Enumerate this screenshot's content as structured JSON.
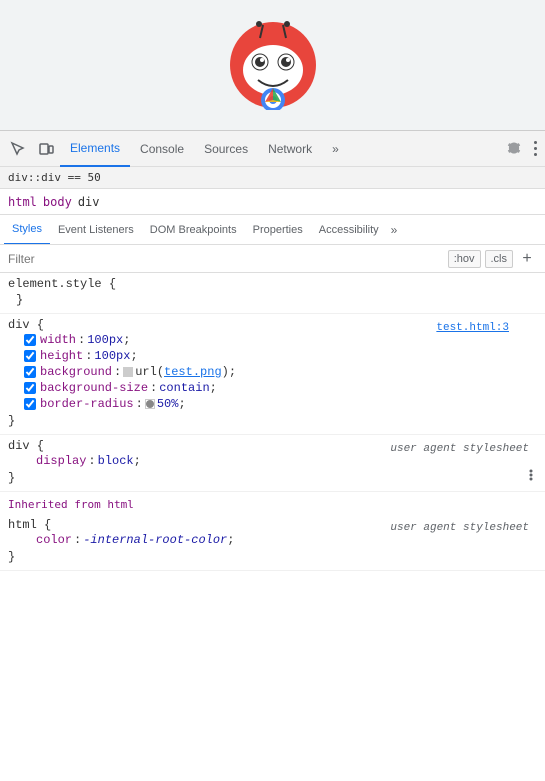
{
  "browser_preview": {
    "logo_alt": "Chrome DevTools Logo"
  },
  "devtools": {
    "path_text": "div::div == 50",
    "tabs": [
      {
        "id": "elements",
        "label": "Elements",
        "active": true
      },
      {
        "id": "console",
        "label": "Console",
        "active": false
      },
      {
        "id": "sources",
        "label": "Sources",
        "active": false
      },
      {
        "id": "network",
        "label": "Network",
        "active": false
      },
      {
        "id": "more",
        "label": "»",
        "active": false
      }
    ],
    "toolbar": {
      "more_label": "⋮",
      "settings_label": "⋮"
    },
    "breadcrumb": {
      "items": [
        "html",
        "body",
        "div"
      ]
    },
    "subtabs": [
      {
        "id": "styles",
        "label": "Styles",
        "active": true
      },
      {
        "id": "event-listeners",
        "label": "Event Listeners",
        "active": false
      },
      {
        "id": "dom-breakpoints",
        "label": "DOM Breakpoints",
        "active": false
      },
      {
        "id": "properties",
        "label": "Properties",
        "active": false
      },
      {
        "id": "accessibility",
        "label": "Accessibility",
        "active": false
      },
      {
        "id": "more2",
        "label": "»",
        "active": false
      }
    ],
    "filter": {
      "placeholder": "Filter",
      "hov_label": ":hov",
      "cls_label": ".cls",
      "add_label": "+"
    },
    "css_rules": [
      {
        "id": "element-style",
        "selector": "element.style {",
        "origin": null,
        "properties": [],
        "close": "}"
      },
      {
        "id": "div-rule",
        "selector": "div {",
        "origin": "test.html:3",
        "properties": [
          {
            "name": "width",
            "value": "100px",
            "checked": true,
            "type": "normal"
          },
          {
            "name": "height",
            "value": "100px",
            "checked": true,
            "type": "normal"
          },
          {
            "name": "background",
            "value": "url(test.png)",
            "checked": true,
            "type": "url",
            "url_text": "test.png"
          },
          {
            "name": "background-size",
            "value": "contain",
            "checked": true,
            "type": "normal"
          },
          {
            "name": "border-radius",
            "value": "50%",
            "checked": true,
            "type": "color_swatch"
          }
        ],
        "close": "}"
      },
      {
        "id": "div-ua",
        "selector": "div {",
        "origin_ua": "user agent stylesheet",
        "properties": [
          {
            "name": "display",
            "value": "block",
            "checked": false,
            "type": "normal"
          }
        ],
        "close": "}"
      }
    ],
    "inherited_header": "Inherited from html",
    "inherited_rules": [
      {
        "id": "html-ua",
        "selector": "html {",
        "origin_ua": "user agent stylesheet",
        "properties": [
          {
            "name": "color",
            "value": "-internal-root-color",
            "checked": false,
            "type": "normal"
          }
        ],
        "close": "}"
      }
    ]
  }
}
